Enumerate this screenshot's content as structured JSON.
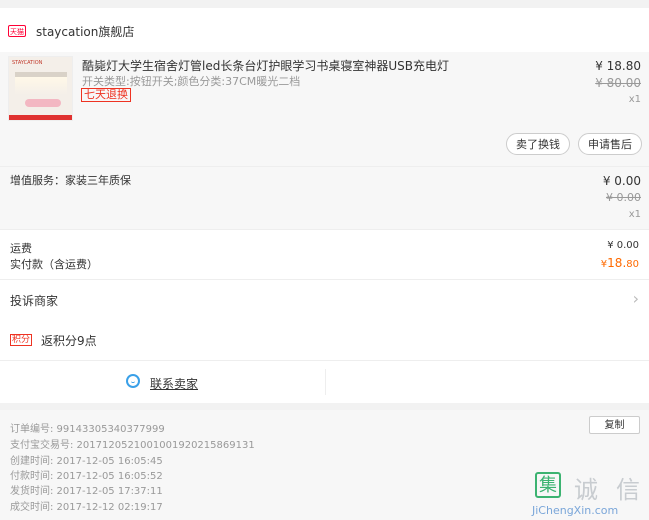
{
  "store": {
    "badge": "天猫",
    "name": "staycation旗舰店",
    "chevron": "›"
  },
  "item": {
    "thumb_brand": "STAYCATION",
    "title": "酷毙灯大学生宿舍灯管led长条台灯护眼学习书桌寝室神器USB充电灯",
    "spec": "开关类型:按钮开关;颜色分类:37CM暖光二档",
    "tag": "七天退换",
    "price": "¥ 18.80",
    "original_price": "¥ 80.00",
    "qty": "x1",
    "buttons": [
      "卖了换钱",
      "申请售后"
    ]
  },
  "service": {
    "label": "增值服务：家装三年质保",
    "price": "¥ 0.00",
    "original_price": "¥ 0.00",
    "qty": "x1"
  },
  "totals": {
    "shipping_label": "运费",
    "shipping_value": "¥ 0.00",
    "paid_label": "实付款（含运费）",
    "paid_currency": "¥",
    "paid_int": "18.",
    "paid_dec": "80"
  },
  "complain": {
    "label": "投诉商家",
    "chevron": "›"
  },
  "points": {
    "tag": "积分",
    "prefix": "返积分",
    "value": "9",
    "suffix": "点"
  },
  "contact": {
    "label": "联系卖家"
  },
  "order_info": {
    "copy_label": "复制",
    "rows": [
      "订单编号:  99143305340377999",
      "支付宝交易号:  2017120521001001920215869131",
      "创建时间:  2017-12-05 16:05:45",
      "付款时间:  2017-12-05 16:05:52",
      "发货时间:  2017-12-05 17:37:11",
      "成交时间:  2017-12-12 02:19:17"
    ]
  },
  "watermark": {
    "c1": "集",
    "c2": "诚",
    "c3": "信",
    "url": "JiChengXin.com"
  },
  "colors": {
    "accent": "#ff6a00",
    "tmall_red": "#ff0036",
    "contact_blue": "#3aa0e8"
  }
}
